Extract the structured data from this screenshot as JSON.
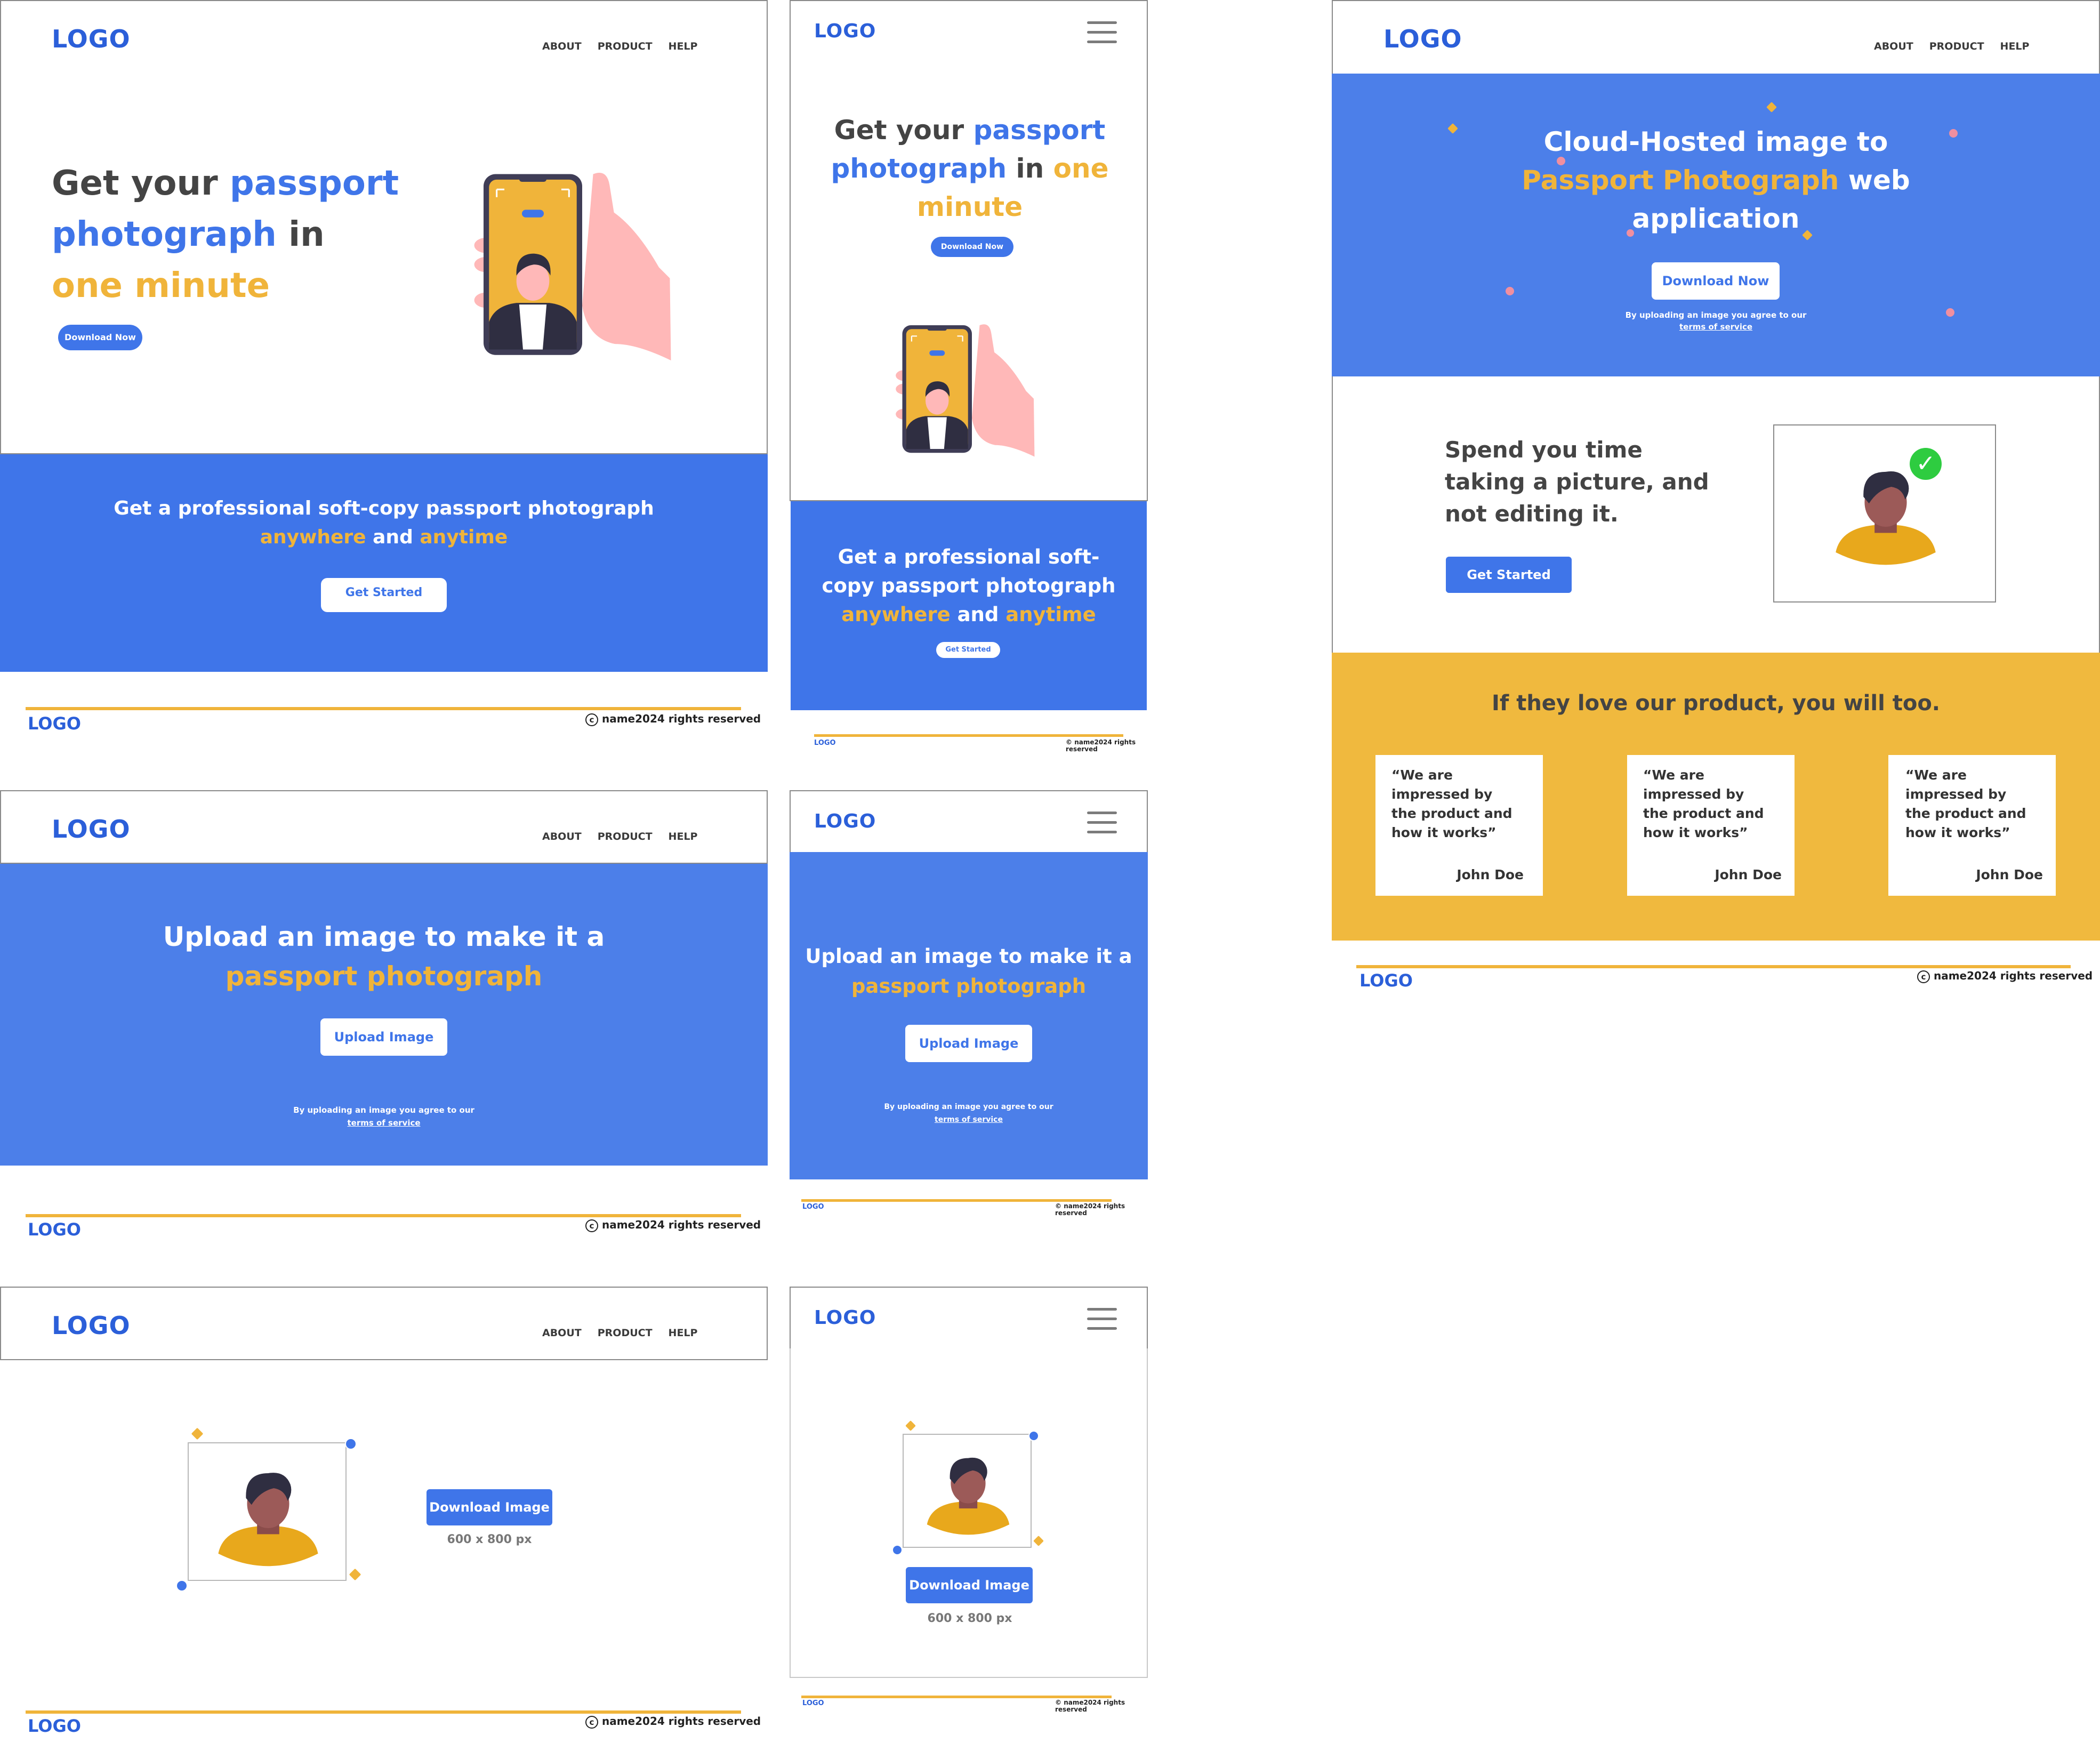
{
  "colors": {
    "blue": "#3f75e9",
    "yellow": "#f0b43a",
    "dark_text": "#444444",
    "skin": "#9c5a58",
    "hand": "#ffb8b8"
  },
  "nav": {
    "logo": "LOGO",
    "about": "ABOUT",
    "product": "PRODUCT",
    "help": "HELP",
    "menu_icon": "hamburger-icon"
  },
  "footer": {
    "logo": "LOGO",
    "copyright": "name2024 rights reserved",
    "copyright_icon": "copyright-icon"
  },
  "home": {
    "headline_1": "Get your",
    "headline_2": "passport",
    "headline_3": "photograph",
    "headline_4": "in",
    "headline_5": "one minute",
    "download_button": "Download Now",
    "banner_line": "Get a professional soft-copy passport photograph",
    "banner_anywhere": "anywhere",
    "banner_and": "and",
    "banner_anytime": "anytime",
    "get_started": "Get Started",
    "m_headline_1": "Get your",
    "m_headline_2": "passport",
    "m_headline_3": "photograph",
    "m_headline_4": "in",
    "m_headline_5": "one",
    "m_headline_6": "minute",
    "m_banner_1": "Get a professional soft-",
    "m_banner_2": "copy passport photograph"
  },
  "upload": {
    "title": "Upload an image to make it a",
    "title_highlight": "passport photograph",
    "button": "Upload Image",
    "terms_1": "By uploading an image you agree to our",
    "terms_link": "terms of service"
  },
  "result": {
    "download_button": "Download Image",
    "size": "600 x 800 px"
  },
  "landing": {
    "hero_1": "Cloud-Hosted image to",
    "hero_highlight": "Passport Photograph",
    "hero_2": "web",
    "hero_3": "application",
    "download_button": "Download Now",
    "terms_1": "By uploading an image you agree to our",
    "terms_link": "terms of service",
    "feature_1": "Spend you time",
    "feature_2": "taking a picture, and",
    "feature_3": "not editing it.",
    "get_started": "Get Started",
    "testimonials_title": "If they love our product, you will too.",
    "testimonials": [
      {
        "quote_1": "“We are",
        "quote_2": "impressed by",
        "quote_3": "the product and",
        "quote_4": "how it works”",
        "author": "John Doe"
      },
      {
        "quote_1": "“We are",
        "quote_2": "impressed by",
        "quote_3": "the product and",
        "quote_4": "how it works”",
        "author": "John Doe"
      },
      {
        "quote_1": "“We are",
        "quote_2": "impressed by",
        "quote_3": "the product and",
        "quote_4": "how it works”",
        "author": "John Doe"
      }
    ]
  }
}
